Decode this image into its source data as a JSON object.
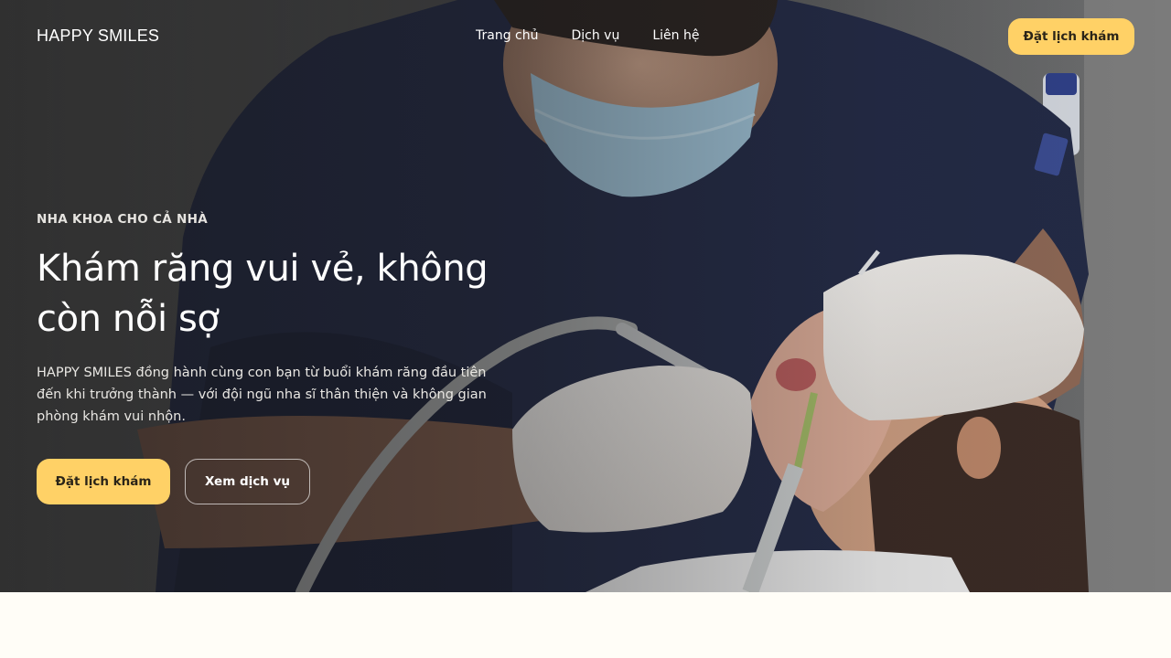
{
  "brand": {
    "logo": "HAPPY SMILES"
  },
  "nav": {
    "links": [
      "Trang chủ",
      "Dịch vụ",
      "Liên hệ"
    ],
    "cta_label": "Đặt lịch khám"
  },
  "hero": {
    "eyebrow": "NHA KHOA CHO CẢ NHÀ",
    "headline_line1": "Khám răng vui vẻ, không",
    "headline_line2": "còn nỗi sợ",
    "description": "HAPPY SMILES đồng hành cùng con bạn từ buổi khám răng đầu tiên đến khi trưởng thành — với đội ngũ nha sĩ thân thiện và không gian phòng khám vui nhộn.",
    "primary_cta": "Đặt lịch khám",
    "secondary_cta": "Xem dịch vụ"
  },
  "colors": {
    "accent": "#ffd166",
    "page_background": "#fffdf7"
  }
}
